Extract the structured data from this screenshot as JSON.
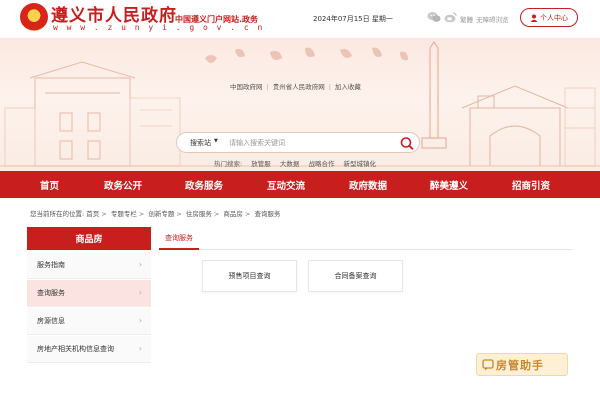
{
  "header": {
    "site_name": "遵义市人民政府",
    "site_url": "w w w . z u n y i . g o v . c n",
    "portal_tag": "中国遵义门户网站.政务",
    "date": "2024年07月15日  星期一",
    "tools": [
      "繁體",
      "无障碍浏览"
    ],
    "user_center": "个人中心"
  },
  "banner": {
    "quick_links": [
      "中国政府网",
      "贵州省人民政府网",
      "加入收藏"
    ],
    "search": {
      "scope": "搜索站",
      "placeholder": "请输入搜索关键词"
    },
    "hot_label": "热门搜索:",
    "hot_terms": [
      "放管服",
      "大数据",
      "战略合作",
      "新型城镇化"
    ]
  },
  "nav": {
    "items": [
      "首页",
      "政务公开",
      "政务服务",
      "互动交流",
      "政府数据",
      "醉美遵义",
      "招商引资"
    ]
  },
  "breadcrumb": {
    "prefix": "您当前所在的位置:",
    "items": [
      "首页",
      "专题专栏",
      "创新专题",
      "住房服务",
      "商品房",
      "查询服务"
    ]
  },
  "sidebar": {
    "title": "商品房",
    "items": [
      {
        "label": "服务指南"
      },
      {
        "label": "查询服务"
      },
      {
        "label": "房源信息"
      },
      {
        "label": "房地产相关机构信息查询"
      }
    ]
  },
  "content": {
    "tab": "查询服务",
    "cards": [
      "预售项目查询",
      "合同备案查询"
    ]
  },
  "assistant": {
    "label": "房管助手"
  },
  "colors": {
    "brand_red": "#c81e1e",
    "sidebar_active": "#fbe3e1",
    "assistant_bg": "#fdf0d6",
    "assistant_text": "#c7892c"
  }
}
